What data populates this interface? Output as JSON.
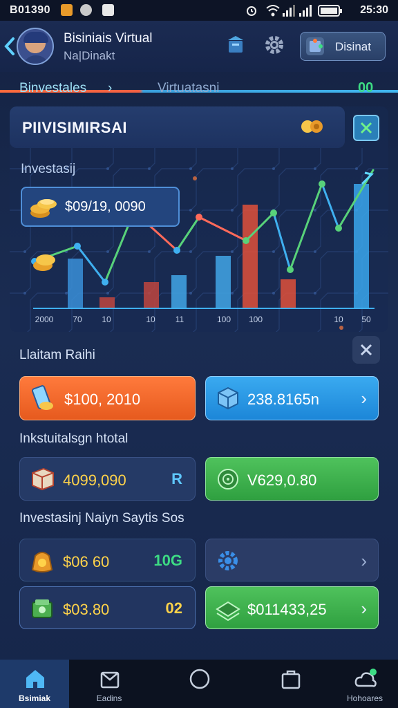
{
  "status_bar": {
    "left_time": "B01390",
    "right_time": "25:30"
  },
  "header": {
    "title": "Bisiniais Virtual",
    "subtitle": "Na|Dinakt",
    "action_label": "Disinat"
  },
  "tabs": {
    "primary": "Binvestales",
    "secondary": "Virtuatasni",
    "count": "00"
  },
  "chart_panel": {
    "title": "PIIVISIMIRSAI",
    "label": "Investasij",
    "value": "$09/19, 0090"
  },
  "chart_data": {
    "type": "bar",
    "x_tick_labels": [
      "2000",
      "70",
      "10",
      "10",
      "11",
      "100",
      "100",
      "10",
      "50"
    ],
    "bars": [
      {
        "value": 0.36,
        "color": "#3a8fd8"
      },
      {
        "value": 0.08,
        "color": "#c0453e"
      },
      {
        "value": 0.19,
        "color": "#c0453e"
      },
      {
        "value": 0.24,
        "color": "#42a6e6"
      },
      {
        "value": 0.38,
        "color": "#42a6e6"
      },
      {
        "value": 0.75,
        "color": "#e0503a"
      },
      {
        "value": 0.21,
        "color": "#e0503a"
      },
      {
        "value": 0.9,
        "color": "#3aa6ec"
      }
    ],
    "line_values": [
      0.34,
      0.45,
      0.19,
      0.7,
      0.42,
      0.66,
      0.49,
      0.69,
      0.28,
      0.9,
      0.58,
      1.0
    ],
    "colors": {
      "up": "#58d27a",
      "down": "#ff6a5a",
      "base": "#3fb0f0"
    }
  },
  "sections": {
    "section1": "Llaitam Raihi",
    "section2": "Inkstuitalsgn htotal",
    "section3": "Investasinj Naiyn Saytis Sos"
  },
  "cards": {
    "orange": {
      "value": "$100, 2010"
    },
    "blue": {
      "value": "238.8165n"
    },
    "dark1": {
      "value": "4099,090",
      "side": "R"
    },
    "green1": {
      "value": "V629,0.80"
    },
    "dark2": {
      "value": "$06 60",
      "side": "10G"
    },
    "dark4": {
      "value": "$03.80",
      "side": "02"
    },
    "green2": {
      "value": "$011433,25"
    }
  },
  "bottom_nav": {
    "items": [
      {
        "label": "Bsimiak",
        "icon": "home-icon"
      },
      {
        "label": "Eadins",
        "icon": "box-icon"
      },
      {
        "label": "",
        "icon": "circle-icon"
      },
      {
        "label": "",
        "icon": "bag-icon"
      },
      {
        "label": "Hohoares",
        "icon": "cloud-icon"
      }
    ]
  },
  "colors": {
    "accent_orange": "#ff7a3c",
    "accent_blue": "#3aaaf0",
    "accent_green": "#4fc25c",
    "background": "#14213f"
  }
}
